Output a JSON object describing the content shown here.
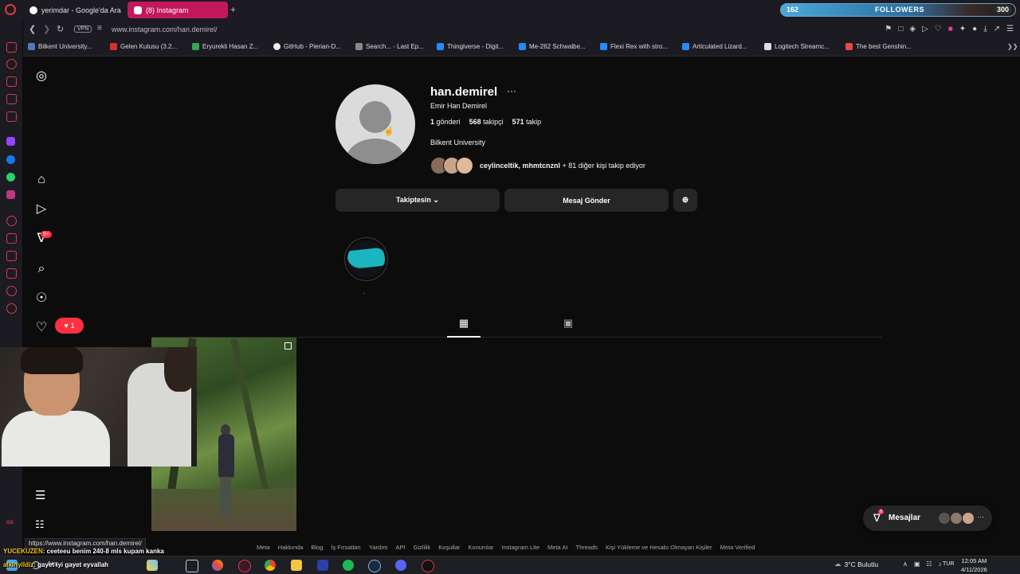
{
  "browser": {
    "tabs": [
      {
        "label": "yerimdar - Google'da Ara"
      },
      {
        "label": "(8) Instagram"
      }
    ],
    "new_tab_symbol": "+",
    "vpn_label": "VPN",
    "url": "www.instagram.com/han.demirel/",
    "bookmarks": [
      {
        "label": "Bilkent University...",
        "color": "#4a7cc0"
      },
      {
        "label": "Gelen Kutusu (3.2...",
        "color": "#d93025"
      },
      {
        "label": "Eryurekli Hasan Z...",
        "color": "#34a853"
      },
      {
        "label": "GitHub - Pierian-D...",
        "color": "#eeeeee"
      },
      {
        "label": "Search... - Last Ep...",
        "color": "#888888"
      },
      {
        "label": "Thingiverse - Digit...",
        "color": "#248bfb"
      },
      {
        "label": "Me-262 Schwalbe...",
        "color": "#248bfb"
      },
      {
        "label": "Flexi Rex with stro...",
        "color": "#248bfb"
      },
      {
        "label": "Articulated Lizard...",
        "color": "#248bfb"
      },
      {
        "label": "Logitech Streamc...",
        "color": "#dddddd"
      },
      {
        "label": "The best Genshin...",
        "color": "#e64a4a"
      }
    ]
  },
  "stream_overlay": {
    "followers_count": "162",
    "followers_label": "FOLLOWERS",
    "followers_goal": "300",
    "chat": [
      {
        "user": "YUCEKUZEN",
        "message": ": ceeteeu benim 240-8 mls kupam kanka"
      },
      {
        "user": "alkinyildiz",
        "message": ": gayet iyi gayet eyvallah"
      }
    ]
  },
  "profile": {
    "username": "han.demirel",
    "more_symbol": "···",
    "full_name": "Emir Han Demirel",
    "posts_count": "1",
    "posts_label": "gönderi",
    "followers_count": "568",
    "followers_label": "takipçi",
    "following_count": "571",
    "following_label": "takip",
    "bio": "Bilkent University",
    "followed_by_names": "ceylinceltik, mhmtcnznl",
    "followed_by_rest": " + 81 diğer kişi takip ediyor",
    "following_button": "Takiptesin ⌄",
    "message_button": "Mesaj Gönder",
    "highlight_label": "."
  },
  "nav": {
    "notifications_badge": "9+",
    "likes_badge": "1"
  },
  "messages_pill": {
    "label": "Mesajlar",
    "badge": "8",
    "more": "···"
  },
  "footer_links": [
    "Meta",
    "Hakkında",
    "Blog",
    "İş Fırsatları",
    "Yardım",
    "API",
    "Gizlilik",
    "Koşullar",
    "Konumlar",
    "Instagram Lite",
    "Meta AI",
    "Threads",
    "Kişi Yükleme ve Hesabı Olmayan Kişiler",
    "Meta Verified"
  ],
  "status_url": "https://www.instagram.com/han.demirel/",
  "taskbar": {
    "search_label": "Ara",
    "weather": "3°C Bulutlu",
    "language": "TUR",
    "time": "12:05 AM",
    "date": "4/11/2026"
  },
  "colors": {
    "instagram_bg": "#0c0c0d",
    "button_bg": "#262626",
    "badge_red": "#ff3040",
    "active_tab": "#c2185b",
    "highlight_teal": "#1bb5c0"
  }
}
